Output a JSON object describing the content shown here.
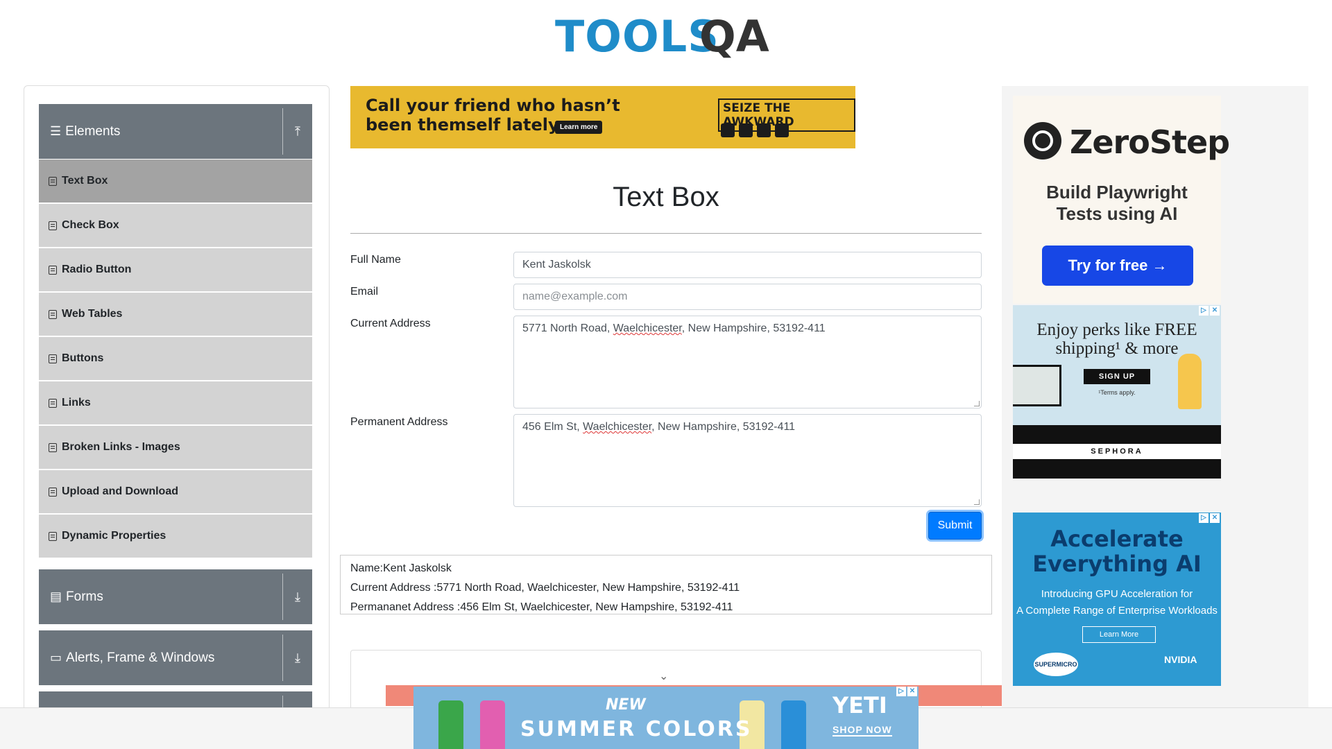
{
  "header": {
    "logo_tools": "TOOLS",
    "logo_qa": "QA"
  },
  "sidebar": {
    "groups": [
      {
        "label": "Elements",
        "icon": "hamburger-icon",
        "toggle": "collapse-arrow-up-icon"
      },
      {
        "label": "Forms",
        "icon": "document-icon",
        "toggle": "expand-arrow-down-icon"
      },
      {
        "label": "Alerts, Frame & Windows",
        "icon": "window-icon",
        "toggle": "expand-arrow-down-icon"
      }
    ],
    "items": [
      {
        "label": "Text Box",
        "active": true
      },
      {
        "label": "Check Box"
      },
      {
        "label": "Radio Button"
      },
      {
        "label": "Web Tables"
      },
      {
        "label": "Buttons"
      },
      {
        "label": "Links"
      },
      {
        "label": "Broken Links - Images"
      },
      {
        "label": "Upload and Download"
      },
      {
        "label": "Dynamic Properties"
      }
    ]
  },
  "top_ad": {
    "headline_line1": "Call your friend who hasn’t",
    "headline_line2": "been themself lately.",
    "cta": "Learn more",
    "brand": "SEIZE THE AWKWARD"
  },
  "main": {
    "title": "Text Box",
    "form": {
      "full_name_label": "Full Name",
      "full_name_value": "Kent Jaskolsk",
      "email_label": "Email",
      "email_placeholder": "name@example.com",
      "current_address_label": "Current Address",
      "current_address_pre": "5771 North Road, ",
      "current_address_word": "Waelchicester",
      "current_address_post": ", New Hampshire, 53192-411",
      "permanent_address_label": "Permanent Address",
      "permanent_address_pre": "456 Elm St, ",
      "permanent_address_word": "Waelchicester",
      "permanent_address_post": ", New Hampshire, 53192-411",
      "submit_label": "Submit"
    },
    "output": {
      "name": "Name:Kent Jaskolsk",
      "current_address": "Current Address :5771 North Road, Waelchicester, New Hampshire, 53192-411",
      "permanent_address": "Permananet Address :456 Elm St, Waelchicester, New Hampshire, 53192-411"
    }
  },
  "right_ads": {
    "zerostep": {
      "brand": "ZeroStep",
      "tagline_line1": "Build Playwright",
      "tagline_line2": "Tests using AI",
      "cta": "Try for free →"
    },
    "sephora": {
      "line1": "Enjoy perks like FREE",
      "line2": "shipping¹ & more",
      "cta": "SIGN UP",
      "terms": "¹Terms apply.",
      "brand": "SEPHORA"
    },
    "nvidia": {
      "line1": "Accelerate",
      "line2": "Everything AI",
      "sub1": "Introducing GPU Acceleration for",
      "sub2": "A Complete Range of Enterprise Workloads",
      "cta": "Learn More",
      "brand1": "SUPERMICRO",
      "brand2": "NVIDIA"
    }
  },
  "bottom_ad": {
    "new": "NEW",
    "headline": "SUMMER COLORS",
    "brand": "YETI",
    "cta": "SHOP NOW"
  }
}
